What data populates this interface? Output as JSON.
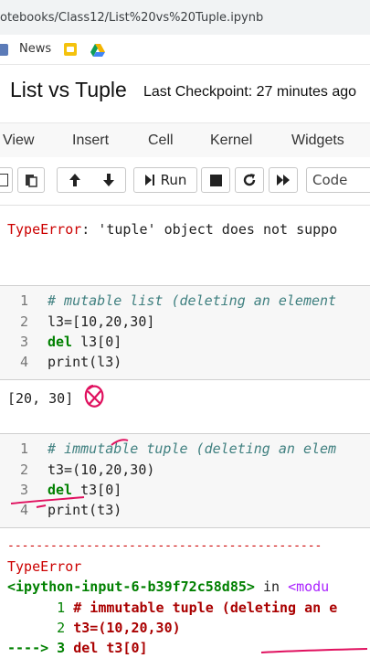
{
  "browser": {
    "url": "otebooks/Class12/List%20vs%20Tuple.ipynb",
    "bookmarks": [
      {
        "label": "News",
        "icon": "news-icon"
      },
      {
        "label": "",
        "icon": "bookmark-yellow-icon"
      },
      {
        "label": "",
        "icon": "drive-icon"
      }
    ]
  },
  "notebook": {
    "title": "List vs Tuple",
    "checkpoint": "Last Checkpoint: 27 minutes ago"
  },
  "menu": {
    "items": [
      "View",
      "Insert",
      "Cell",
      "Kernel",
      "Widgets"
    ]
  },
  "toolbar": {
    "run_label": "Run",
    "cell_type": "Code"
  },
  "top_output": {
    "error_name": "TypeError",
    "error_rest": ": 'tuple' object does not suppo"
  },
  "cell1": {
    "lines": [
      {
        "no": "1",
        "text": "# mutable list (deleting an element"
      },
      {
        "no": "2",
        "text": "l3=[10,20,30]"
      },
      {
        "no": "3",
        "kw": "del",
        "text": " l3[0]"
      },
      {
        "no": "4",
        "text": "print(l3)"
      }
    ],
    "output": "[20, 30]"
  },
  "cell2": {
    "lines": [
      {
        "no": "1",
        "text": "# immutable tuple (deleting an elem"
      },
      {
        "no": "2",
        "text": "t3=(10,20,30)"
      },
      {
        "no": "3",
        "kw": "del",
        "text": " t3[0]"
      },
      {
        "no": "4",
        "text": "print(t3)"
      }
    ]
  },
  "traceback": {
    "dashes": "--------------------------------------------",
    "error_name": "TypeError",
    "input_ref": "<ipython-input-6-b39f72c58d85>",
    "in_text": " in ",
    "module": "<modu",
    "lines": [
      {
        "prefix": "      1 ",
        "text": "# immutable tuple (deleting an e"
      },
      {
        "prefix": "      2 ",
        "text": "t3=(10,20,30)"
      },
      {
        "prefix": "----> 3 ",
        "text": "del t3[0]"
      }
    ]
  },
  "colors": {
    "error_red": "#cc0000",
    "annotation_red": "#e0115f",
    "comment": "#408080",
    "keyword": "#008000"
  }
}
